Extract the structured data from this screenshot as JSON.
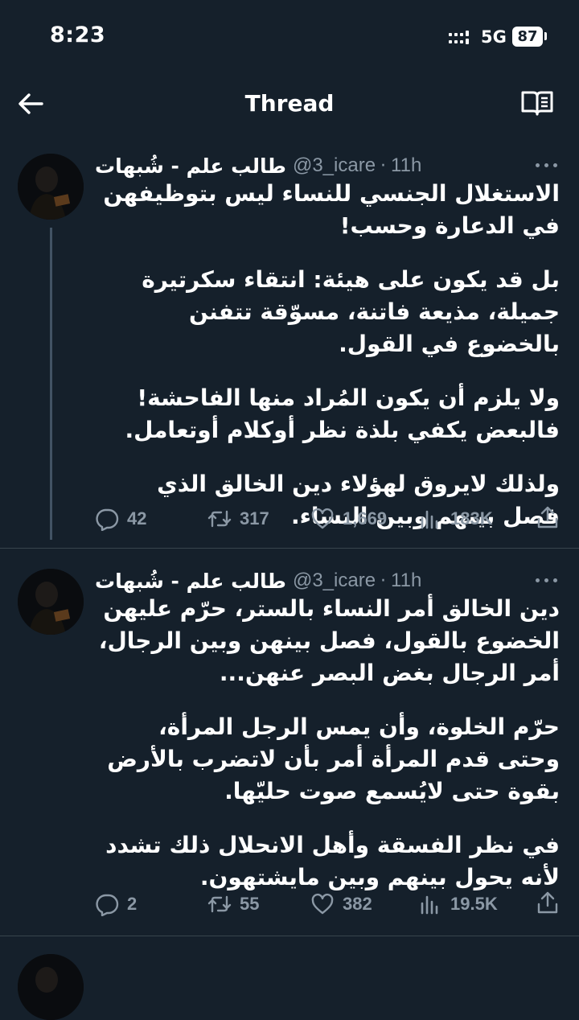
{
  "status_bar": {
    "time": "8:23",
    "network": "5G",
    "battery": "87"
  },
  "header": {
    "title": "Thread"
  },
  "tweets": [
    {
      "name": "طالب علم - شُبهات",
      "handle": "@3_icare",
      "time": "11h",
      "paragraphs": [
        "الاستغلال الجنسي للنساء ليس بتوظيفهن في الدعارة وحسب!",
        "بل قد يكون على هيئة: انتقاء سكرتيرة جميلة، مذيعة فاتنة، مسوّقة تتفنن بالخضوع في القول.",
        "ولا يلزم أن يكون المُراد منها الفاحشة! فالبعض يكفي بلذة نظر أوكلام أوتعامل.",
        "ولذلك لايروق لهؤلاء دين الخالق الذي فصل بينهم وبين النساء."
      ],
      "replies": "42",
      "retweets": "317",
      "likes": "1,669",
      "views": "183K"
    },
    {
      "name": "طالب علم - شُبهات",
      "handle": "@3_icare",
      "time": "11h",
      "paragraphs": [
        "دين الخالق أمر النساء بالستر، حرّم عليهن الخضوع بالقول، فصل بينهن وبين الرجال، أمر الرجال بغض البصر عنهن...",
        "حرّم الخلوة، وأن يمس الرجل المرأة، وحتى قدم المرأة أمر بأن لاتضرب بالأرض بقوة حتى لايُسمع صوت حليّها.",
        "في نظر الفسقة وأهل الانحلال ذلك تشدد لأنه يحول بينهم وبين مايشتهون."
      ],
      "replies": "2",
      "retweets": "55",
      "likes": "382",
      "views": "19.5K"
    }
  ],
  "icons": {
    "back": "arrow-left-icon",
    "reader": "book-open-icon",
    "more": "more-horizontal-icon",
    "reply": "reply-icon",
    "retweet": "retweet-icon",
    "like": "heart-icon",
    "views": "views-icon",
    "share": "share-icon"
  },
  "colors": {
    "background": "#15202b",
    "text": "#ffffff",
    "secondary": "#8b98a5",
    "divider": "#38444d"
  }
}
